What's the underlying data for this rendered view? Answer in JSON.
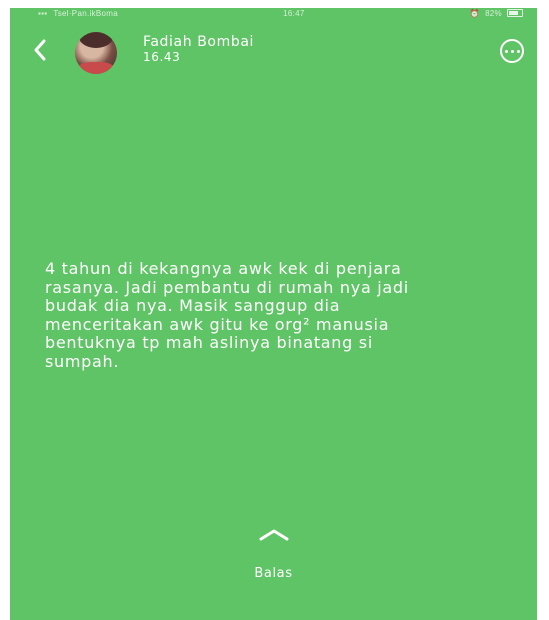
{
  "status_bar": {
    "carrier": "Tsel·Pan.ikBoma",
    "clock": "16:47",
    "battery": "82%"
  },
  "header": {
    "name": "Fadiah Bombai",
    "time": "16.43",
    "back_icon": "chevron-left-icon",
    "more_icon": "more-horizontal-icon"
  },
  "story": {
    "text": "4 tahun di kekangnya awk kek di penjara\nrasanya. Jadi pembantu di rumah nya jadi\nbudak dia nya. Masik sanggup dia\nmenceritakan awk gitu ke org² manusia\nbentuknya tp mah aslinya binatang si\nsumpah."
  },
  "reply": {
    "label": "Balas",
    "icon": "chevron-up-icon"
  },
  "colors": {
    "background": "#5fc465",
    "text": "#ffffff"
  }
}
